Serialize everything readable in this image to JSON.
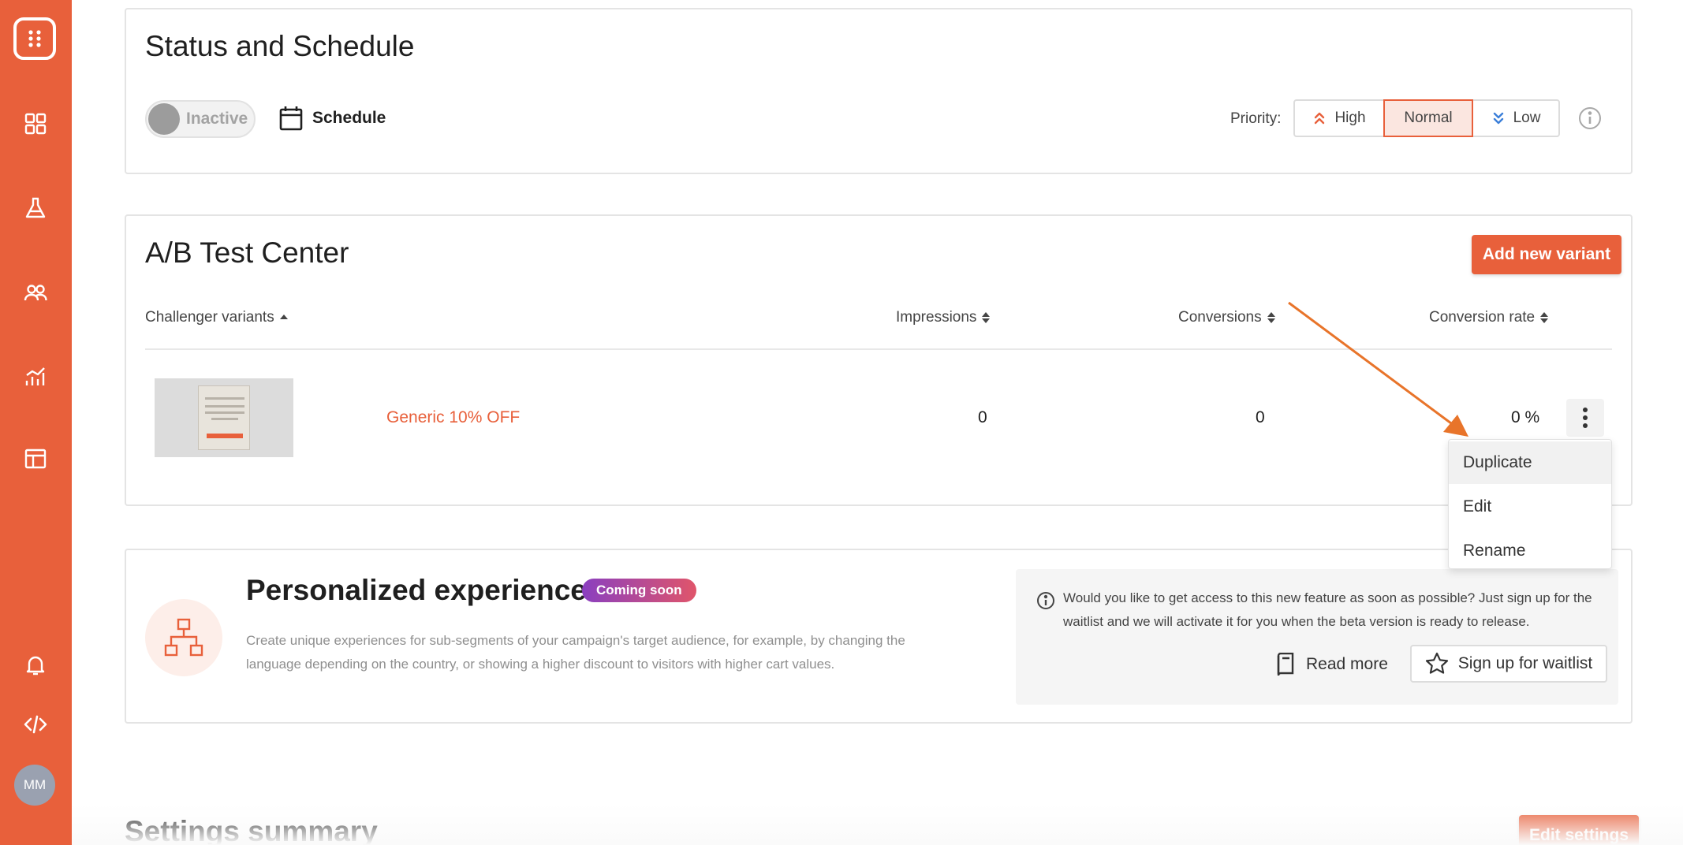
{
  "sidebar": {
    "items": [
      {
        "icon": "grid-icon"
      },
      {
        "icon": "flask-icon"
      },
      {
        "icon": "users-icon"
      },
      {
        "icon": "analytics-icon"
      },
      {
        "icon": "layout-icon"
      },
      {
        "icon": "bell-icon"
      },
      {
        "icon": "code-icon"
      }
    ],
    "avatar_initials": "MM"
  },
  "status": {
    "title": "Status and Schedule",
    "toggle_label": "Inactive",
    "schedule_label": "Schedule",
    "priority_label": "Priority:",
    "priority_options": [
      "High",
      "Normal",
      "Low"
    ],
    "priority_selected": "Normal"
  },
  "ab_test": {
    "title": "A/B Test Center",
    "add_button": "Add new variant",
    "columns": [
      "Challenger variants",
      "Impressions",
      "Conversions",
      "Conversion rate"
    ],
    "rows": [
      {
        "name": "Generic 10% OFF",
        "impressions": "0",
        "conversions": "0",
        "conversion_rate": "0 %"
      }
    ]
  },
  "menu": {
    "items": [
      "Duplicate",
      "Edit",
      "Rename"
    ],
    "highlighted": "Duplicate"
  },
  "personalized": {
    "title": "Personalized experiences",
    "badge": "Coming soon",
    "description": "Create unique experiences for sub-segments of your campaign's target audience, for example, by changing the language depending on the country, or showing a higher discount to visitors with higher cart values.",
    "waitlist_text": "Would you like to get access to this new feature as soon as possible? Just sign up for the waitlist and we will activate it for you when the beta version is ready to release.",
    "read_more": "Read more",
    "waitlist_button": "Sign up for waitlist"
  },
  "settings": {
    "title": "Settings summary",
    "edit_button": "Edit settings"
  },
  "colors": {
    "accent": "#e8603b",
    "annotation_arrow": "#e8742a"
  }
}
